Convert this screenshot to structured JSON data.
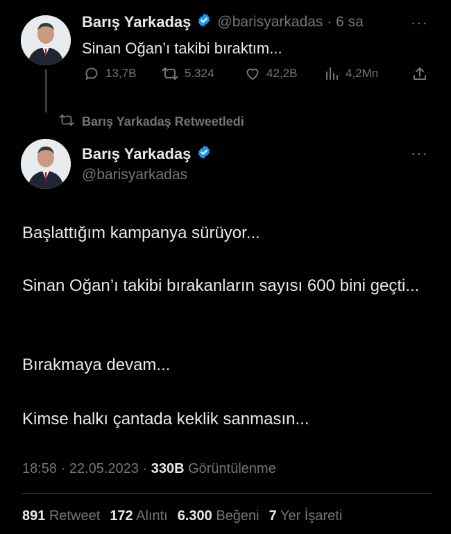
{
  "first_tweet": {
    "author_name": "Barış Yarkadaş",
    "handle_time": "@barisyarkadas · 6 sa",
    "text": "Sinan Oğan’ı takibi bıraktım...",
    "actions": {
      "replies": "13,7B",
      "retweets": "5.324",
      "likes": "42,2B",
      "views": "4,2Mn"
    }
  },
  "retweet_banner": {
    "label": "Barış Yarkadaş Retweetledi"
  },
  "main_tweet": {
    "author_name": "Barış Yarkadaş",
    "handle": "@barisyarkadas",
    "paragraphs": [
      "Başlattığım kampanya sürüyor...",
      "Sinan Oğan’ı takibi bırakanların sayısı 600 bini geçti...",
      "Bırakmaya devam...",
      "Kimse halkı çantada keklik sanmasın..."
    ],
    "timestamp": "18:58 · 22.05.2023 · ",
    "views_count": "330B",
    "views_label": "Görüntülenme",
    "stats": [
      {
        "count": "891",
        "label": "Retweet"
      },
      {
        "count": "172",
        "label": "Alıntı"
      },
      {
        "count": "6.300",
        "label": "Beğeni"
      },
      {
        "count": "7",
        "label": "Yer İşareti"
      }
    ]
  },
  "colors": {
    "background": "#000000",
    "text": "#e7e9ea",
    "muted": "#71767b",
    "verified": "#1d9bf0"
  },
  "icons": {
    "verified": "verified-badge-icon",
    "more": "more-icon",
    "reply": "reply-icon",
    "retweet": "retweet-icon",
    "like": "heart-icon",
    "views": "views-icon",
    "share": "share-icon"
  }
}
